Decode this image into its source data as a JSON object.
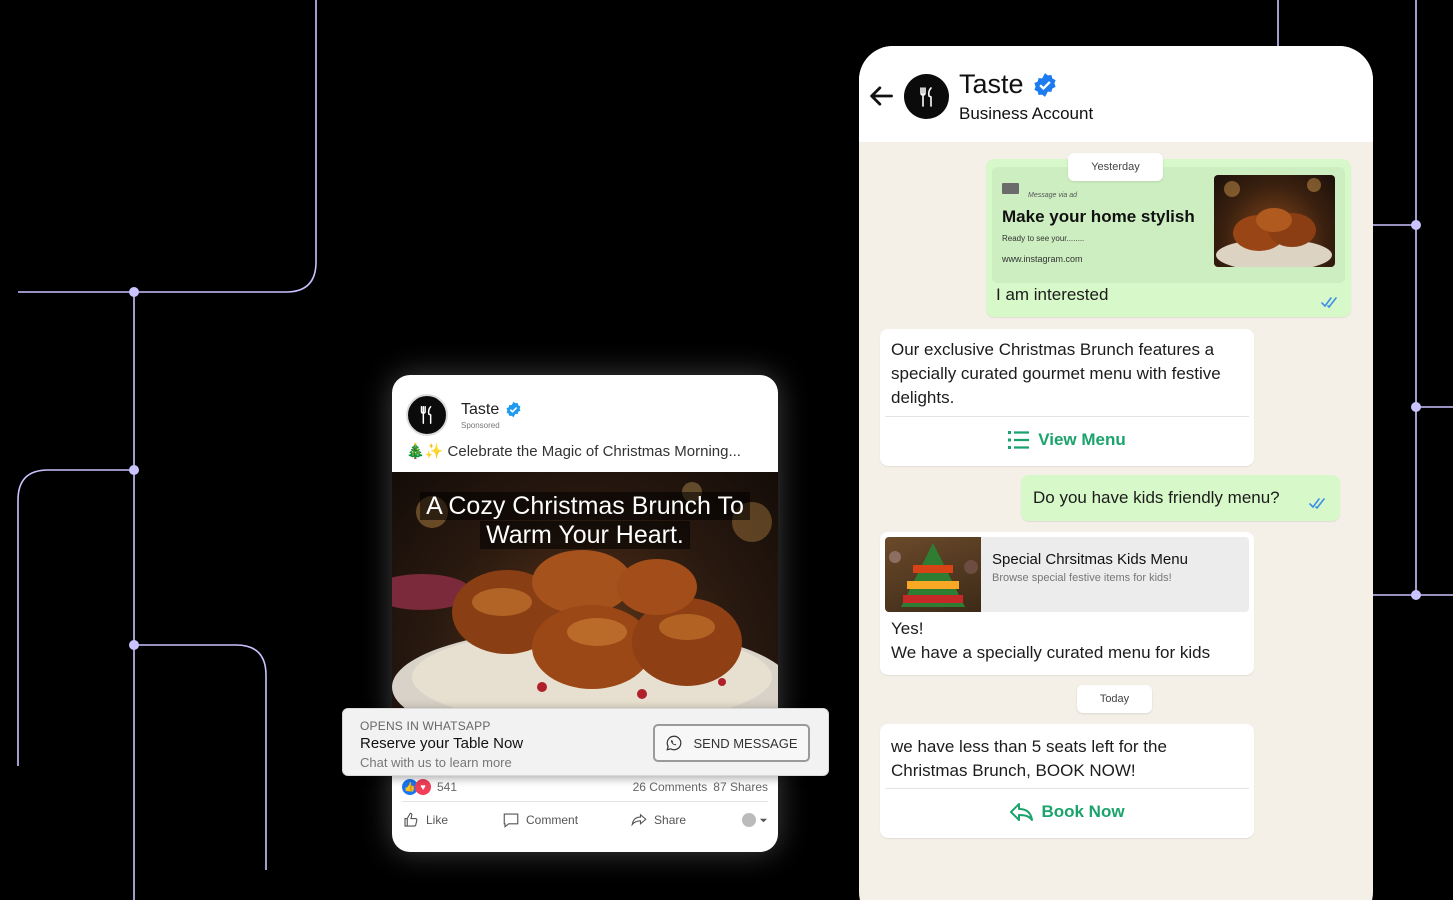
{
  "facebook_post": {
    "page_name": "Taste",
    "sponsored_label": "Sponsored",
    "caption": "🎄✨ Celebrate the Magic of Christmas Morning...",
    "image_headline_line1": "A Cozy Christmas Brunch To",
    "image_headline_line2": "Warm Your Heart.",
    "cta": {
      "overline": "OPENS IN WHATSAPP",
      "title": "Reserve your Table Now",
      "subtitle": "Chat with us to learn more",
      "button_label": "SEND MESSAGE"
    },
    "reactions_count": "541",
    "comments": "26 Comments",
    "shares": "87 Shares",
    "actions": {
      "like": "Like",
      "comment": "Comment",
      "share": "Share"
    }
  },
  "whatsapp": {
    "contact_name": "Taste",
    "contact_subtitle": "Business Account",
    "date_yesterday": "Yesterday",
    "ad_reply": {
      "via_label": "Message via ad",
      "title": "Make your home stylish",
      "subtitle": "Ready to see your........",
      "url": "www.instagram.com",
      "message": "I am interested"
    },
    "menu_message": {
      "text": "Our exclusive Christmas Brunch features a specially curated gourmet menu with festive delights.",
      "button_label": "View Menu"
    },
    "kids_question": "Do you have kids friendly menu?",
    "kids_reply": {
      "card_title": "Special Chrsitmas Kids Menu",
      "card_subtitle": "Browse special festive items for kids!",
      "line1": "Yes!",
      "line2": "We have a specially curated menu for kids"
    },
    "date_today": "Today",
    "book_message": {
      "text": "we have less than 5 seats left for the Christmas Brunch, BOOK NOW!",
      "button_label": "Book Now"
    }
  },
  "colors": {
    "background": "#000000",
    "line": "#c9c3ff",
    "outgoing_bubble": "#d7f8c8",
    "wa_chat_bg": "#f4f0e8",
    "wa_action_green": "#1aa36c",
    "verified_blue": "#1d9bf0",
    "read_tick_blue": "#3b8fe8"
  }
}
